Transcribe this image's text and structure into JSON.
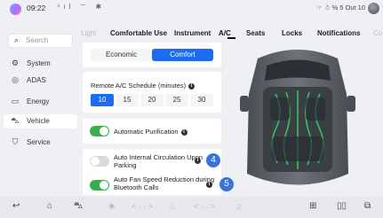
{
  "status_bar": {
    "time": "09:22",
    "right_text": "☞ ☃ ℅ 5 Out 10"
  },
  "sidebar": {
    "search_placeholder": "Search",
    "items": [
      {
        "label": "System",
        "icon": "gear-icon"
      },
      {
        "label": "ADAS",
        "icon": "steering-wheel-icon"
      },
      {
        "label": "Energy",
        "icon": "battery-icon"
      },
      {
        "label": "Vehicle",
        "icon": "car-icon",
        "active": true
      },
      {
        "label": "Service",
        "icon": "service-icon"
      }
    ]
  },
  "tabs": [
    {
      "label": "Light",
      "state": "dim"
    },
    {
      "label": "Comfortable Use"
    },
    {
      "label": "Instrument"
    },
    {
      "label": "A/C",
      "active": true
    },
    {
      "label": "Seats"
    },
    {
      "label": "Locks"
    },
    {
      "label": "Notifications"
    },
    {
      "label": "Co",
      "state": "dim"
    }
  ],
  "ac_mode": {
    "options": [
      "Economic",
      "Comfort"
    ],
    "selected": "Comfort"
  },
  "schedule": {
    "label": "Remote A/C Schedule (minutes)",
    "options": [
      "10",
      "15",
      "20",
      "25",
      "30"
    ],
    "selected": "10"
  },
  "auto_purification": {
    "label": "Automatic Purification",
    "on": true
  },
  "internal_circulation": {
    "label_line1": "Auto Internal Circulation Upon",
    "label_line2": "Parking",
    "on": false,
    "badge": "4"
  },
  "fan_speed": {
    "label_line1": "Auto Fan Speed Reduction during",
    "label_line2": "Bluetooth Calls",
    "on": true,
    "badge": "5"
  },
  "bottom_bar": {
    "left_nav": "< - - >",
    "right_nav": "< - - >"
  },
  "colors": {
    "accent": "#1b6cf2",
    "toggle_on": "#34b04a",
    "badge": "#3b74d8"
  }
}
